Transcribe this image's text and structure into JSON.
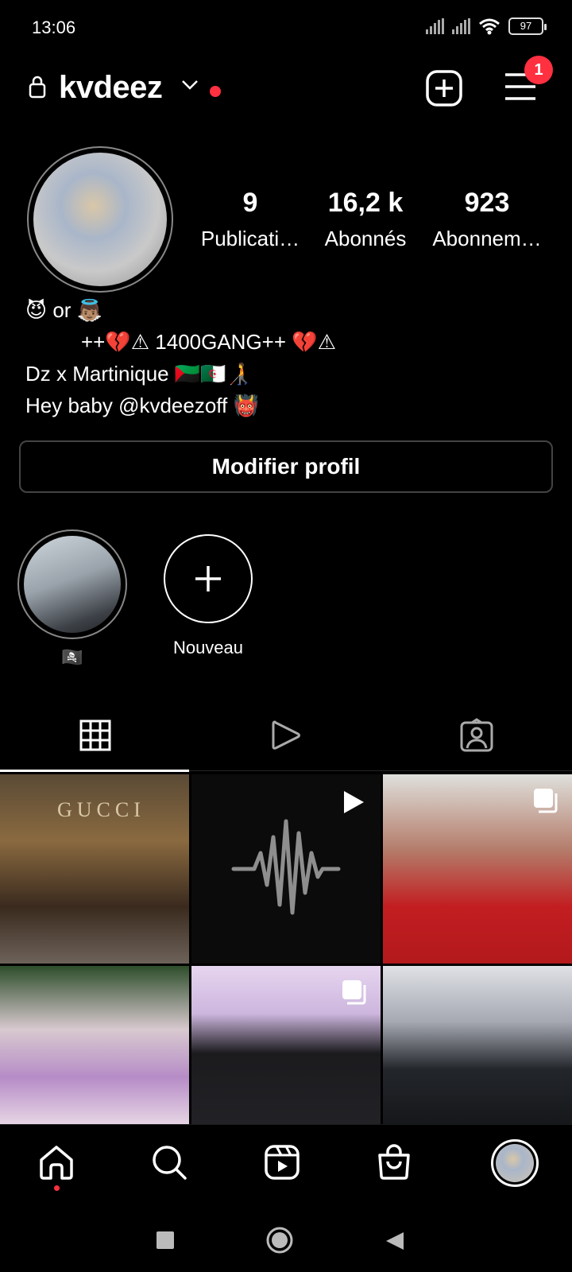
{
  "status_bar": {
    "time": "13:06",
    "battery": "97"
  },
  "header": {
    "username": "kvdeez",
    "notification_count": "1"
  },
  "stats": [
    {
      "number": "9",
      "label": "Publicati…"
    },
    {
      "number": "16,2 k",
      "label": "Abonnés"
    },
    {
      "number": "923",
      "label": "Abonnem…"
    }
  ],
  "bio": {
    "line1": "😈 or 👼🏽",
    "line2": "++💔⚠ 1400GANG++ 💔⚠",
    "line3": "Dz x Martinique 🇲🇶🇩🇿🧑‍🦯",
    "line4": "Hey baby @kvdeezoff 👹"
  },
  "edit_profile_label": "Modifier profil",
  "highlights": [
    {
      "label": "🏴‍☠️"
    },
    {
      "label": "Nouveau"
    }
  ],
  "grid": {
    "post1_sign": "GUCCI"
  },
  "colors": {
    "accent_red": "#ff3040",
    "background": "#000000",
    "border": "#444444"
  },
  "icons": [
    "lock-icon",
    "chevron-down-icon",
    "new-post-icon",
    "menu-icon",
    "grid-icon",
    "reels-icon",
    "tagged-icon",
    "home-icon",
    "search-icon",
    "reels-nav-icon",
    "shop-icon"
  ]
}
